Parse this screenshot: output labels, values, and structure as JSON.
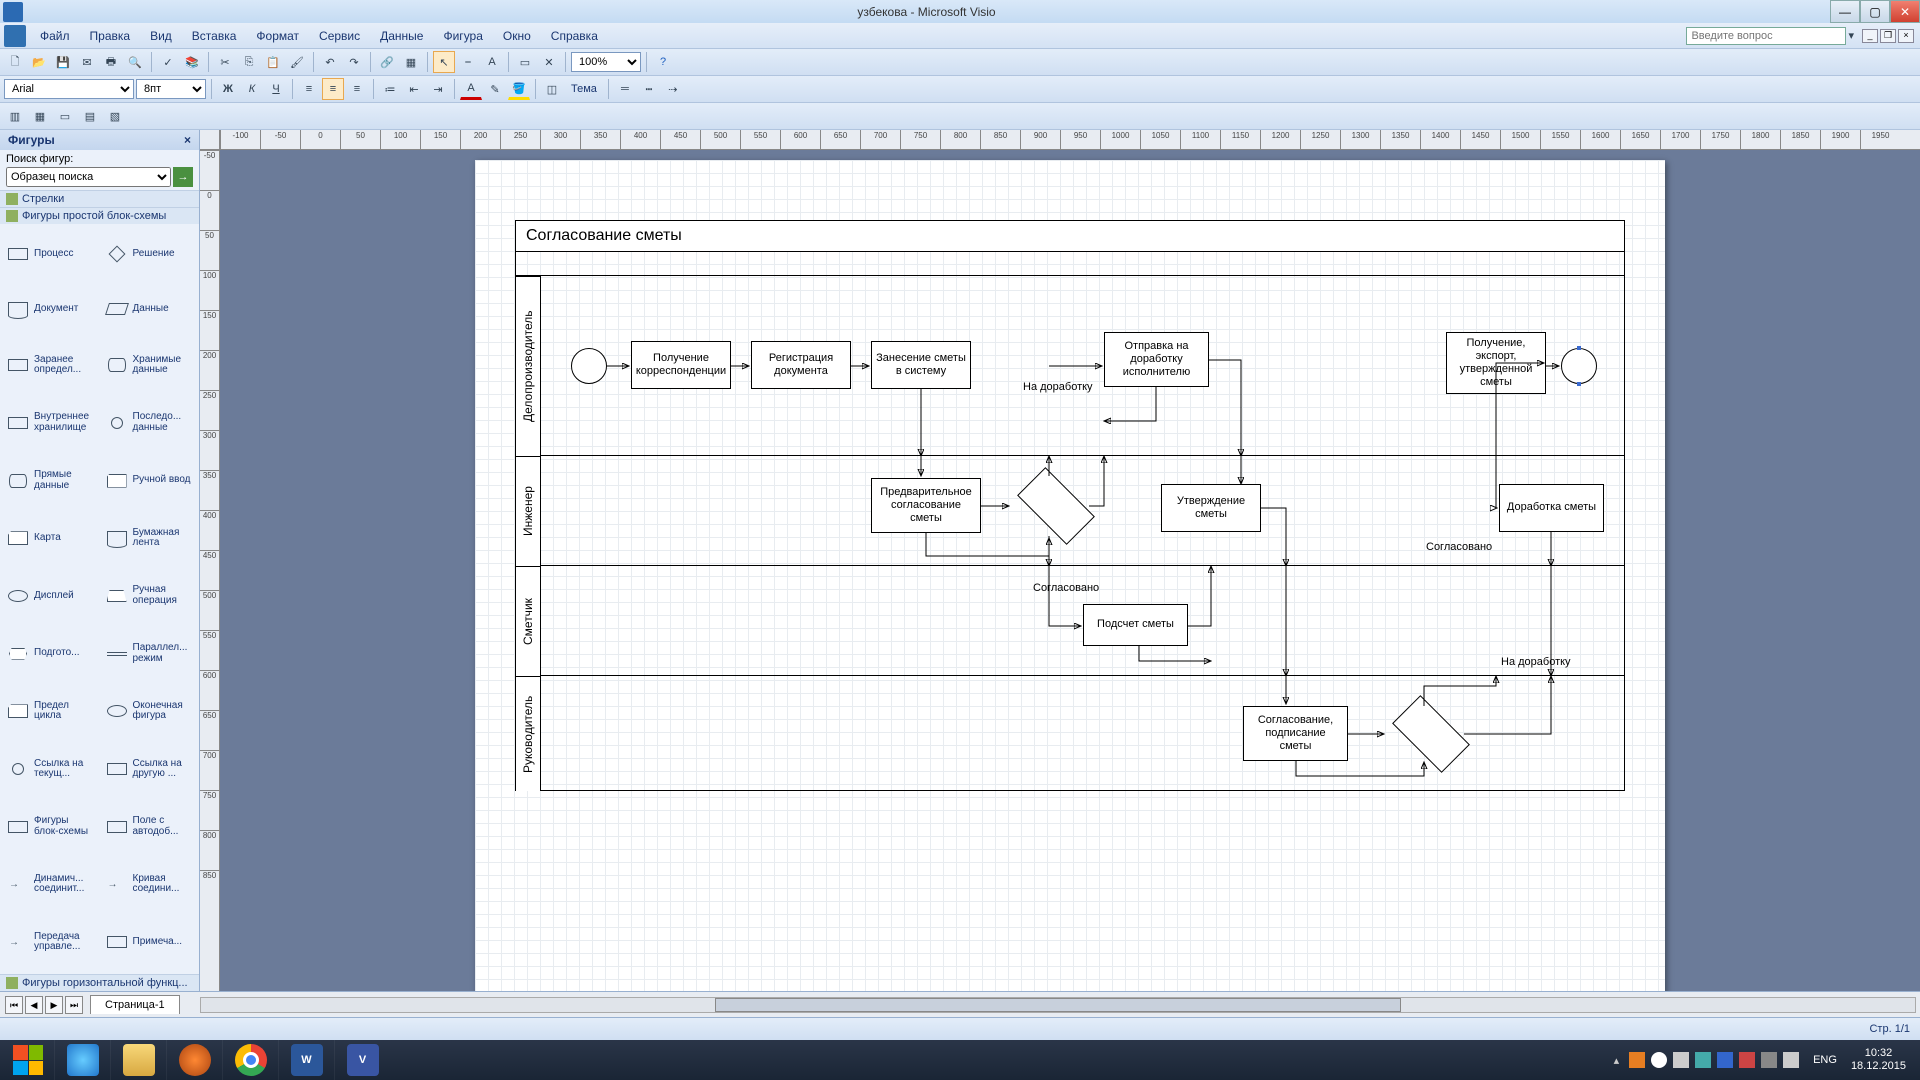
{
  "title": "узбекова - Microsoft Visio",
  "menu": [
    "Файл",
    "Правка",
    "Вид",
    "Вставка",
    "Формат",
    "Сервис",
    "Данные",
    "Фигура",
    "Окно",
    "Справка"
  ],
  "search_placeholder": "Введите вопрос",
  "font_name": "Arial",
  "font_size": "8пт",
  "zoom": "100%",
  "theme_label": "Тема",
  "shapes_panel": {
    "title": "Фигуры",
    "search_label": "Поиск фигур:",
    "search_sample": "Образец поиска",
    "stencil1": "Стрелки",
    "stencil2": "Фигуры простой блок-схемы",
    "footer": "Фигуры горизонтальной функц...",
    "shapes": [
      {
        "l": "Процесс",
        "g": "gl-rect"
      },
      {
        "l": "Решение",
        "g": "gl-diamond"
      },
      {
        "l": "Документ",
        "g": "gl-doc"
      },
      {
        "l": "Данные",
        "g": "gl-para"
      },
      {
        "l": "Заранее определ...",
        "g": "gl-rect"
      },
      {
        "l": "Хранимые данные",
        "g": "gl-cyl"
      },
      {
        "l": "Внутреннее хранилище",
        "g": "gl-rect"
      },
      {
        "l": "Последо... данные",
        "g": "gl-circ"
      },
      {
        "l": "Прямые данные",
        "g": "gl-cyl"
      },
      {
        "l": "Ручной ввод",
        "g": "gl-card"
      },
      {
        "l": "Карта",
        "g": "gl-card"
      },
      {
        "l": "Бумажная лента",
        "g": "gl-doc"
      },
      {
        "l": "Дисплей",
        "g": "gl-oval"
      },
      {
        "l": "Ручная операция",
        "g": "gl-trap"
      },
      {
        "l": "Подгото...",
        "g": "gl-hex"
      },
      {
        "l": "Параллел... режим",
        "g": "gl-lines"
      },
      {
        "l": "Предел цикла",
        "g": "gl-card"
      },
      {
        "l": "Оконечная фигура",
        "g": "gl-oval"
      },
      {
        "l": "Ссылка на текущ...",
        "g": "gl-circ"
      },
      {
        "l": "Ссылка на другую ...",
        "g": "gl-rect"
      },
      {
        "l": "Фигуры блок-схемы",
        "g": "gl-rect"
      },
      {
        "l": "Поле с автодоб...",
        "g": "gl-rect"
      },
      {
        "l": "Динамич... соединит...",
        "g": "gl-arrow"
      },
      {
        "l": "Кривая соедини...",
        "g": "gl-arrow"
      },
      {
        "l": "Передача управле...",
        "g": "gl-arrow"
      },
      {
        "l": "Примеча...",
        "g": "gl-rect"
      }
    ]
  },
  "ruler_h": [
    "-100",
    "-50",
    "0",
    "50",
    "100",
    "150",
    "200",
    "250",
    "300",
    "350",
    "400",
    "450",
    "500",
    "550",
    "600",
    "650",
    "700",
    "750",
    "800",
    "850",
    "900",
    "950",
    "1000",
    "1050",
    "1100",
    "1150",
    "1200",
    "1250",
    "1300",
    "1350",
    "1400",
    "1450",
    "1500",
    "1550",
    "1600",
    "1650",
    "1700",
    "1750",
    "1800",
    "1850",
    "1900",
    "1950"
  ],
  "ruler_v": [
    "-50",
    "0",
    "50",
    "100",
    "150",
    "200",
    "250",
    "300",
    "350",
    "400",
    "450",
    "500",
    "550",
    "600",
    "650",
    "700",
    "750",
    "800",
    "850"
  ],
  "diagram": {
    "title": "Согласование сметы",
    "lanes": [
      "Делопроизводитель",
      "Инженер",
      "Сметчик",
      "Руководитель"
    ],
    "boxes": {
      "b1": "Получение корреспонденции",
      "b2": "Регистрация документа",
      "b3": "Занесение сметы в систему",
      "b4": "Отправка на доработку исполнителю",
      "b5": "Получение, экспорт, утвержденной сметы",
      "b6": "Предварительное согласование сметы",
      "b7": "Утверждение сметы",
      "b8": "Доработка сметы",
      "b9": "Подсчет сметы",
      "b10": "Согласование, подписание сметы"
    },
    "labels": {
      "l1": "На доработку",
      "l2": "Согласовано",
      "l3": "Согласовано",
      "l4": "На доработку"
    }
  },
  "page_tab": "Страница-1",
  "status": "Стр. 1/1",
  "taskbar": {
    "lang": "ENG",
    "time": "10:32",
    "date": "18.12.2015"
  }
}
